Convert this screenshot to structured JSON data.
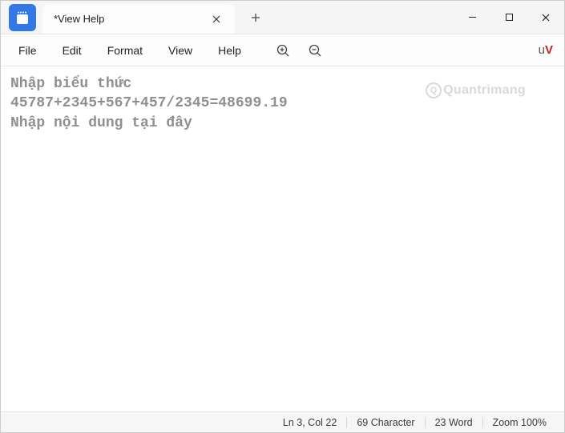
{
  "title": {
    "tab_title": "*View Help"
  },
  "menubar": {
    "file": "File",
    "edit": "Edit",
    "format": "Format",
    "view": "View",
    "help": "Help"
  },
  "brand": {
    "u": "u",
    "v": "V"
  },
  "editor": {
    "line1": "Nhập biểu thức",
    "line2": "45787+2345+567+457/2345=48699.19",
    "line3": "Nhập nội dung tại đây"
  },
  "watermark": {
    "text": "Quantrimang"
  },
  "statusbar": {
    "ln_col": "Ln 3, Col 22",
    "characters": "69 Character",
    "words": "23 Word",
    "zoom": "Zoom 100%"
  }
}
